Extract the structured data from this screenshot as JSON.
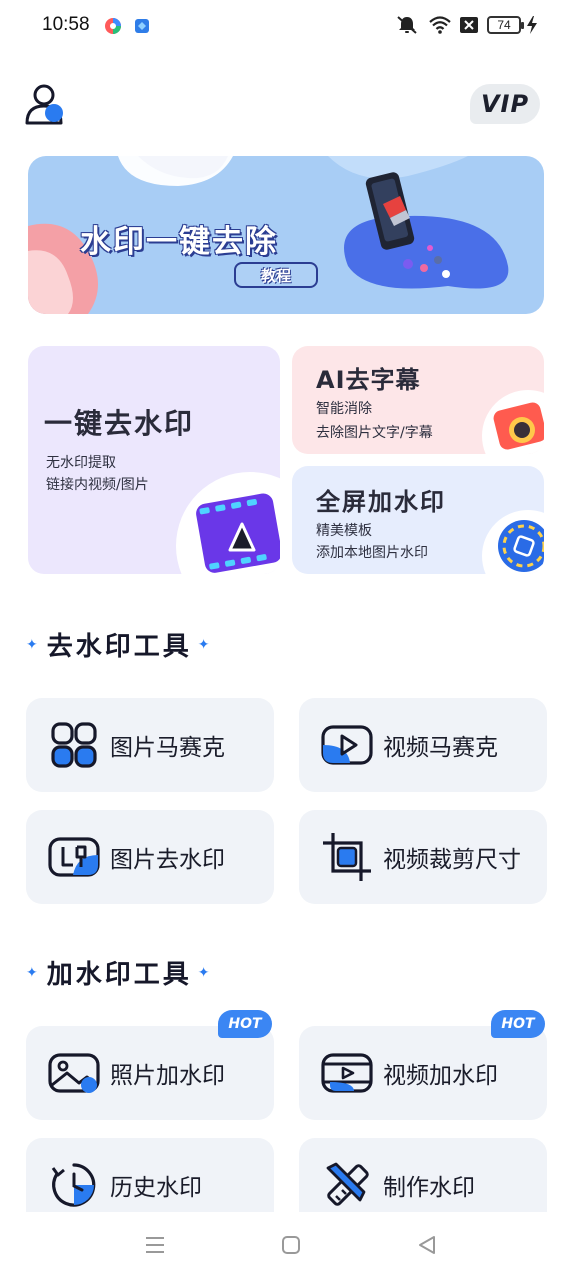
{
  "status_bar": {
    "time": "10:58",
    "battery": "74"
  },
  "header": {
    "vip_label": "VIP"
  },
  "banner": {
    "title": "水印一键去除",
    "button": "教程"
  },
  "features": {
    "remove": {
      "title": "一键去水印",
      "line1": "无水印提取",
      "line2": "链接内视频/图片"
    },
    "subtitle": {
      "title": "AI去字幕",
      "line1": "智能消除",
      "line2": "去除图片文字/字幕"
    },
    "fullscreen": {
      "title": "全屏加水印",
      "line1": "精美模板",
      "line2": "添加本地图片水印"
    }
  },
  "section_remove": {
    "title": "去水印工具",
    "tiles": [
      {
        "label": "图片马赛克",
        "icon": "grid-icon"
      },
      {
        "label": "视频马赛克",
        "icon": "play-icon"
      },
      {
        "label": "图片去水印",
        "icon": "stamp-icon"
      },
      {
        "label": "视频裁剪尺寸",
        "icon": "crop-icon"
      }
    ]
  },
  "section_add": {
    "title": "加水印工具",
    "tiles": [
      {
        "label": "照片加水印",
        "icon": "image-icon",
        "badge": "HOT"
      },
      {
        "label": "视频加水印",
        "icon": "video-icon",
        "badge": "HOT"
      },
      {
        "label": "历史水印",
        "icon": "history-icon"
      },
      {
        "label": "制作水印",
        "icon": "pencil-ruler-icon"
      }
    ]
  },
  "colors": {
    "accent": "#2a7bf0",
    "tile_bg": "#f0f3f8",
    "dark": "#1b1d2b"
  }
}
